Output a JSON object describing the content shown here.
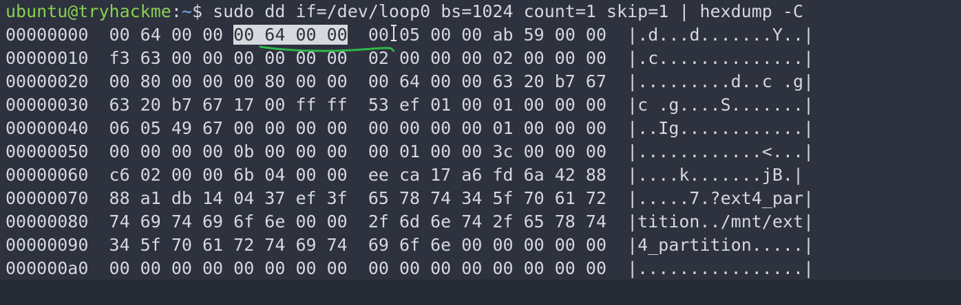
{
  "prompt": {
    "user_host": "ubuntu@tryhackme",
    "sep": ":",
    "cwd": "~",
    "symbol": "$ ",
    "command": "sudo dd if=/dev/loop0 bs=1024 count=1 skip=1 | hexdump -C"
  },
  "hexdump": {
    "rows": [
      {
        "offset": "00000000",
        "hex_a": "00 64 00 00 ",
        "hex_sel": "00 64 00 00",
        "hex_b": "00 05 00 00 ab 59 00 00",
        "ascii": "|.d...d.......Y..|"
      },
      {
        "offset": "00000010",
        "hex_a": "f3 63 00 00 00 00 00 00",
        "hex_sel": "",
        "hex_b": "02 00 00 00 02 00 00 00",
        "ascii": "|.c..............|"
      },
      {
        "offset": "00000020",
        "hex_a": "00 80 00 00 00 80 00 00",
        "hex_sel": "",
        "hex_b": "00 64 00 00 63 20 b7 67",
        "ascii": "|.........d..c .g|"
      },
      {
        "offset": "00000030",
        "hex_a": "63 20 b7 67 17 00 ff ff",
        "hex_sel": "",
        "hex_b": "53 ef 01 00 01 00 00 00",
        "ascii": "|c .g....S.......|"
      },
      {
        "offset": "00000040",
        "hex_a": "06 05 49 67 00 00 00 00",
        "hex_sel": "",
        "hex_b": "00 00 00 00 01 00 00 00",
        "ascii": "|..Ig............|"
      },
      {
        "offset": "00000050",
        "hex_a": "00 00 00 00 0b 00 00 00",
        "hex_sel": "",
        "hex_b": "00 01 00 00 3c 00 00 00",
        "ascii": "|............<...|"
      },
      {
        "offset": "00000060",
        "hex_a": "c6 02 00 00 6b 04 00 00",
        "hex_sel": "",
        "hex_b": "ee ca 17 a6 fd 6a 42 88",
        "ascii": "|....k.......jB.|"
      },
      {
        "offset": "00000070",
        "hex_a": "88 a1 db 14 04 37 ef 3f",
        "hex_sel": "",
        "hex_b": "65 78 74 34 5f 70 61 72",
        "ascii": "|.....7.?ext4_par|"
      },
      {
        "offset": "00000080",
        "hex_a": "74 69 74 69 6f 6e 00 00",
        "hex_sel": "",
        "hex_b": "2f 6d 6e 74 2f 65 78 74",
        "ascii": "|tition../mnt/ext|"
      },
      {
        "offset": "00000090",
        "hex_a": "34 5f 70 61 72 74 69 74",
        "hex_sel": "",
        "hex_b": "69 6f 6e 00 00 00 00 00",
        "ascii": "|4_partition.....|"
      },
      {
        "offset": "000000a0",
        "hex_a": "00 00 00 00 00 00 00 00",
        "hex_sel": "",
        "hex_b": "00 00 00 00 00 00 00 00",
        "ascii": "|................|"
      }
    ]
  },
  "colors": {
    "background": "#2d323e",
    "text": "#d5d8df",
    "prompt_user": "#8ad04f",
    "prompt_path": "#6fa8e8",
    "selection": "#d7d9de",
    "annotation": "#2fb84a"
  },
  "icons": {
    "cursor": "text-cursor-icon",
    "annotation": "underline-annotation-icon"
  }
}
